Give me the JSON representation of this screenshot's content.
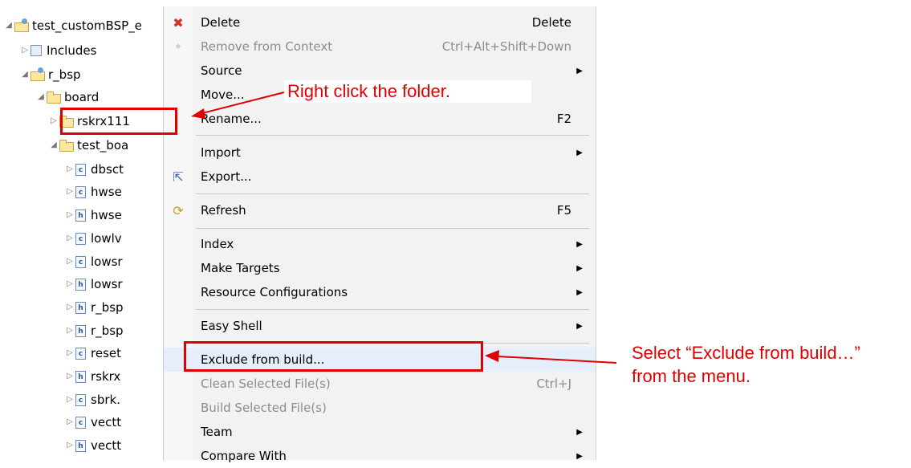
{
  "tree": {
    "items": [
      {
        "label": "test_customBSP_e",
        "kind": "proj"
      },
      {
        "label": "Includes",
        "kind": "inc"
      },
      {
        "label": "r_bsp",
        "kind": "proj"
      },
      {
        "label": "board",
        "kind": "folder"
      },
      {
        "label": "rskrx111",
        "kind": "folder"
      },
      {
        "label": "test_boa",
        "kind": "folder"
      },
      {
        "label": "dbsct",
        "kind": "c"
      },
      {
        "label": "hwse",
        "kind": "c"
      },
      {
        "label": "hwse",
        "kind": "h"
      },
      {
        "label": "lowlv",
        "kind": "c"
      },
      {
        "label": "lowsr",
        "kind": "c"
      },
      {
        "label": "lowsr",
        "kind": "h"
      },
      {
        "label": "r_bsp",
        "kind": "h"
      },
      {
        "label": "r_bsp",
        "kind": "h"
      },
      {
        "label": "reset",
        "kind": "c"
      },
      {
        "label": "rskrx",
        "kind": "h"
      },
      {
        "label": "sbrk.",
        "kind": "c"
      },
      {
        "label": "vectt",
        "kind": "c"
      },
      {
        "label": "vectt",
        "kind": "h"
      }
    ]
  },
  "menu": {
    "items": [
      {
        "label": "Delete",
        "shortcut": "Delete",
        "icon": "delete-icon"
      },
      {
        "label": "Remove from Context",
        "shortcut": "Ctrl+Alt+Shift+Down",
        "disabled": true
      },
      {
        "label": "Source",
        "submenu": true
      },
      {
        "label": "Move..."
      },
      {
        "label": "Rename...",
        "shortcut": "F2"
      },
      {
        "label": "Import",
        "submenu": true
      },
      {
        "label": "Export...",
        "icon": "export-icon"
      },
      {
        "label": "Refresh",
        "shortcut": "F5",
        "icon": "refresh-icon"
      },
      {
        "label": "Index",
        "submenu": true
      },
      {
        "label": "Make Targets",
        "submenu": true
      },
      {
        "label": "Resource Configurations",
        "submenu": true
      },
      {
        "label": "Easy Shell",
        "submenu": true
      },
      {
        "label": "Exclude from build..."
      },
      {
        "label": "Clean Selected File(s)",
        "shortcut": "Ctrl+J",
        "disabled": true
      },
      {
        "label": "Build Selected File(s)",
        "disabled": true
      },
      {
        "label": "Team",
        "submenu": true
      },
      {
        "label": "Compare With",
        "submenu": true
      }
    ]
  },
  "annotations": {
    "right_click": "Right click the folder.",
    "select_line1": "Select “Exclude from build…”",
    "select_line2": "from the menu.",
    "color": "#e00000"
  }
}
